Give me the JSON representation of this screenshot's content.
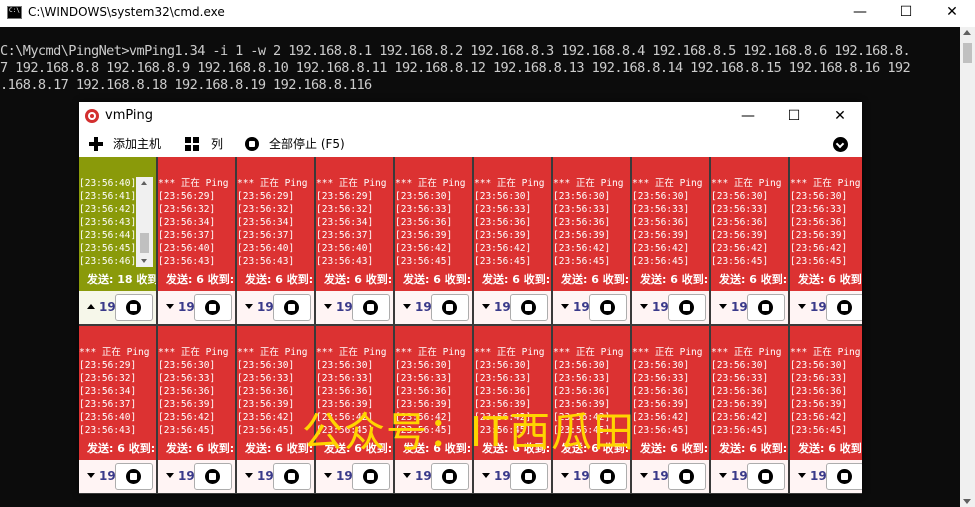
{
  "cmd": {
    "title": "C:\\WINDOWS\\system32\\cmd.exe",
    "lines": [
      "C:\\Mycmd\\PingNet>vmPing1.34 -i 1 -w 2 192.168.8.1 192.168.8.2 192.168.8.3 192.168.8.4 192.168.8.5 192.168.8.6 192.168.8.",
      "7 192.168.8.8 192.168.8.9 192.168.8.10 192.168.8.11 192.168.8.12 192.168.8.13 192.168.8.14 192.168.8.15 192.168.8.16 192",
      ".168.8.17 192.168.8.18 192.168.8.19 192.168.8.116"
    ]
  },
  "window_controls": {
    "minimize": "—",
    "maximize": "☐",
    "close": "✕"
  },
  "vmping": {
    "title": "vmPing",
    "toolbar": {
      "add_host": "添加主机",
      "columns": "列",
      "stop_all": "全部停止 (F5)"
    },
    "host_prefix": "19",
    "colors": {
      "red": "#dc3232",
      "green": "#8a9a0a",
      "text_white": "#ffffff",
      "watermark": "#ffd400"
    },
    "row1": [
      {
        "status": "green",
        "lines": [
          "[23:56:40]",
          "[23:56:41]",
          "[23:56:42]",
          "[23:56:43]",
          "[23:56:44]",
          "[23:56:45]",
          "[23:56:46]"
        ],
        "stats": "发送: 18 收到:",
        "arrow": "up"
      },
      {
        "status": "red",
        "lines": [
          "*** 正在 Ping",
          "[23:56:29]",
          "[23:56:32]",
          "[23:56:34]",
          "[23:56:37]",
          "[23:56:40]",
          "[23:56:43]"
        ],
        "stats": "发送: 6 收到:",
        "arrow": "down"
      },
      {
        "status": "red",
        "lines": [
          "*** 正在 Ping",
          "[23:56:29]",
          "[23:56:32]",
          "[23:56:34]",
          "[23:56:37]",
          "[23:56:40]",
          "[23:56:43]"
        ],
        "stats": "发送: 6 收到:",
        "arrow": "down"
      },
      {
        "status": "red",
        "lines": [
          "*** 正在 Ping",
          "[23:56:29]",
          "[23:56:32]",
          "[23:56:34]",
          "[23:56:37]",
          "[23:56:40]",
          "[23:56:43]"
        ],
        "stats": "发送: 6 收到:",
        "arrow": "down"
      },
      {
        "status": "red",
        "lines": [
          "*** 正在 Ping",
          "[23:56:30]",
          "[23:56:33]",
          "[23:56:36]",
          "[23:56:39]",
          "[23:56:42]",
          "[23:56:45]"
        ],
        "stats": "发送: 6 收到:",
        "arrow": "down"
      },
      {
        "status": "red",
        "lines": [
          "*** 正在 Ping",
          "[23:56:30]",
          "[23:56:33]",
          "[23:56:36]",
          "[23:56:39]",
          "[23:56:42]",
          "[23:56:45]"
        ],
        "stats": "发送: 6 收到:",
        "arrow": "down"
      },
      {
        "status": "red",
        "lines": [
          "*** 正在 Ping",
          "[23:56:30]",
          "[23:56:33]",
          "[23:56:36]",
          "[23:56:39]",
          "[23:56:42]",
          "[23:56:45]"
        ],
        "stats": "发送: 6 收到:",
        "arrow": "down"
      },
      {
        "status": "red",
        "lines": [
          "*** 正在 Ping",
          "[23:56:30]",
          "[23:56:33]",
          "[23:56:36]",
          "[23:56:39]",
          "[23:56:42]",
          "[23:56:45]"
        ],
        "stats": "发送: 6 收到:",
        "arrow": "down"
      },
      {
        "status": "red",
        "lines": [
          "*** 正在 Ping",
          "[23:56:30]",
          "[23:56:33]",
          "[23:56:36]",
          "[23:56:39]",
          "[23:56:42]",
          "[23:56:45]"
        ],
        "stats": "发送: 6 收到:",
        "arrow": "down"
      },
      {
        "status": "red",
        "lines": [
          "*** 正在 Ping",
          "[23:56:30]",
          "[23:56:33]",
          "[23:56:36]",
          "[23:56:39]",
          "[23:56:42]",
          "[23:56:45]"
        ],
        "stats": "发送: 6 收到:",
        "arrow": "down"
      }
    ],
    "row2": [
      {
        "status": "red",
        "lines": [
          "*** 正在 Ping",
          "[23:56:29]",
          "[23:56:32]",
          "[23:56:34]",
          "[23:56:37]",
          "[23:56:40]",
          "[23:56:43]"
        ],
        "stats": "发送: 6 收到:",
        "arrow": "down"
      },
      {
        "status": "red",
        "lines": [
          "*** 正在 Ping",
          "[23:56:30]",
          "[23:56:33]",
          "[23:56:36]",
          "[23:56:39]",
          "[23:56:42]",
          "[23:56:45]"
        ],
        "stats": "发送: 6 收到:",
        "arrow": "down"
      },
      {
        "status": "red",
        "lines": [
          "*** 正在 Ping",
          "[23:56:30]",
          "[23:56:33]",
          "[23:56:36]",
          "[23:56:39]",
          "[23:56:42]",
          "[23:56:45]"
        ],
        "stats": "发送: 6 收到:",
        "arrow": "down"
      },
      {
        "status": "red",
        "lines": [
          "*** 正在 Ping",
          "[23:56:30]",
          "[23:56:33]",
          "[23:56:36]",
          "[23:56:39]",
          "[23:56:42]",
          "[23:56:45]"
        ],
        "stats": "发送: 6 收到:",
        "arrow": "down"
      },
      {
        "status": "red",
        "lines": [
          "*** 正在 Ping",
          "[23:56:30]",
          "[23:56:33]",
          "[23:56:36]",
          "[23:56:39]",
          "[23:56:42]",
          "[23:56:45]"
        ],
        "stats": "发送: 6 收到:",
        "arrow": "down"
      },
      {
        "status": "red",
        "lines": [
          "*** 正在 Ping",
          "[23:56:30]",
          "[23:56:33]",
          "[23:56:36]",
          "[23:56:39]",
          "[23:56:42]",
          "[23:56:45]"
        ],
        "stats": "发送: 6 收到:",
        "arrow": "down"
      },
      {
        "status": "red",
        "lines": [
          "*** 正在 Ping",
          "[23:56:30]",
          "[23:56:33]",
          "[23:56:36]",
          "[23:56:39]",
          "[23:56:42]",
          "[23:56:45]"
        ],
        "stats": "发送: 6 收到:",
        "arrow": "down"
      },
      {
        "status": "red",
        "lines": [
          "*** 正在 Ping",
          "[23:56:30]",
          "[23:56:33]",
          "[23:56:36]",
          "[23:56:39]",
          "[23:56:42]",
          "[23:56:45]"
        ],
        "stats": "发送: 6 收到:",
        "arrow": "down"
      },
      {
        "status": "red",
        "lines": [
          "*** 正在 Ping",
          "[23:56:30]",
          "[23:56:33]",
          "[23:56:36]",
          "[23:56:39]",
          "[23:56:42]",
          "[23:56:45]"
        ],
        "stats": "发送: 6 收到:",
        "arrow": "down"
      },
      {
        "status": "red",
        "lines": [
          "*** 正在 Ping",
          "[23:56:30]",
          "[23:56:33]",
          "[23:56:36]",
          "[23:56:39]",
          "[23:56:42]",
          "[23:56:45]"
        ],
        "stats": "发送: 6 收到:",
        "arrow": "down"
      }
    ]
  },
  "watermark": "公众号：IT西瓜田"
}
